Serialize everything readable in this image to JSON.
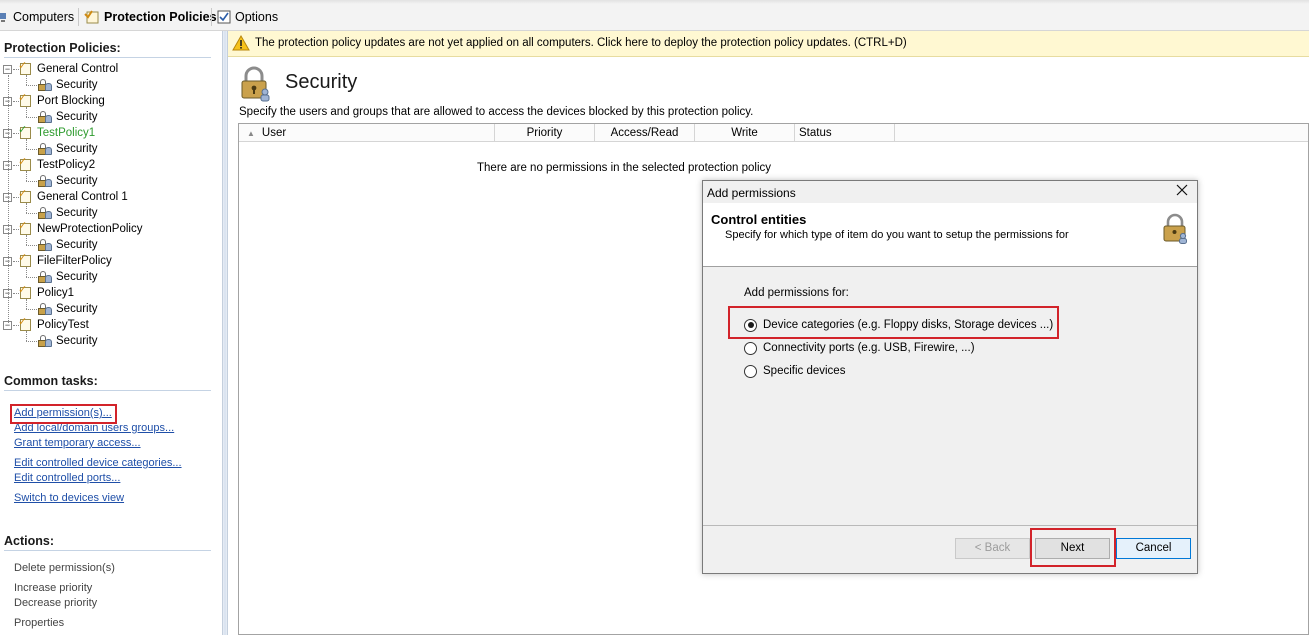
{
  "toolbar": {
    "computers_label": "Computers",
    "policies_label": "Protection Policies",
    "options_label": "Options"
  },
  "left_panel": {
    "policies_title": "Protection Policies:",
    "policies": [
      {
        "name": "General Control",
        "child": "Security",
        "color": "#000000"
      },
      {
        "name": "Port Blocking",
        "child": "Security",
        "color": "#000000"
      },
      {
        "name": "TestPolicy1",
        "child": "Security",
        "color": "#2e9b2e"
      },
      {
        "name": "TestPolicy2",
        "child": "Security",
        "color": "#000000"
      },
      {
        "name": "General Control 1",
        "child": "Security",
        "color": "#000000"
      },
      {
        "name": "NewProtectionPolicy",
        "child": "Security",
        "color": "#000000"
      },
      {
        "name": "FileFilterPolicy",
        "child": "Security",
        "color": "#000000"
      },
      {
        "name": "Policy1",
        "child": "Security",
        "color": "#000000"
      },
      {
        "name": "PolicyTest",
        "child": "Security",
        "color": "#000000"
      }
    ],
    "common_tasks_title": "Common tasks:",
    "common_tasks": [
      "Add permission(s)...",
      "Add local/domain users groups...",
      "Grant temporary access...",
      "Edit controlled device categories...",
      "Edit controlled ports...",
      "Switch to devices view"
    ],
    "actions_title": "Actions:",
    "actions": [
      "Delete permission(s)",
      "Increase priority",
      "Decrease priority",
      "Properties"
    ]
  },
  "infobar": {
    "text": "The protection policy updates are not yet applied on all computers. Click here to deploy the protection policy updates. (CTRL+D)",
    "icon": "warning-icon"
  },
  "main": {
    "title": "Security",
    "description": "Specify the users and groups that are allowed to access the devices blocked by this protection policy.",
    "columns": [
      "User",
      "Priority",
      "Access/Read",
      "Write",
      "Status"
    ],
    "empty_message": "There are no permissions in the selected protection policy"
  },
  "dialog": {
    "title": "Add permissions",
    "header_title": "Control entities",
    "header_subtitle": "Specify for which type of item do you want to setup the permissions for",
    "body_label": "Add permissions for:",
    "options": [
      {
        "label": "Device categories (e.g. Floppy disks, Storage devices ...)",
        "selected": true
      },
      {
        "label": "Connectivity ports (e.g. USB, Firewire, ...)",
        "selected": false
      },
      {
        "label": "Specific devices",
        "selected": false
      }
    ],
    "back_label": "< Back",
    "next_label": "Next",
    "cancel_label": "Cancel"
  },
  "colors": {
    "link": "#1f4fa8",
    "highlight": "#d2232a",
    "infobar_bg": "#fff8d2"
  }
}
